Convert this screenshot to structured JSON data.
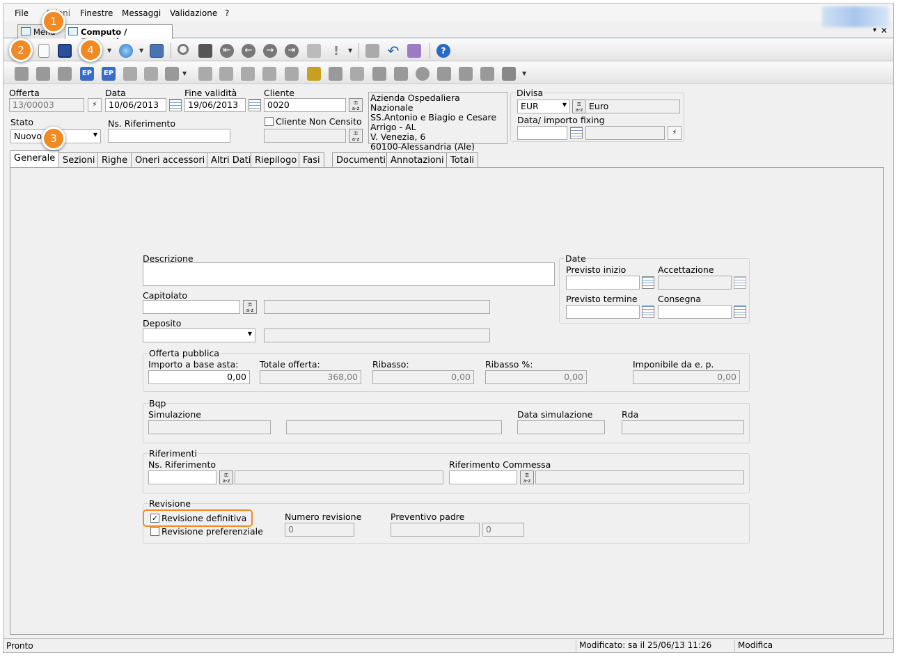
{
  "menu": {
    "file": "File",
    "azioni": "Azioni",
    "finestre": "Finestre",
    "messaggi": "Messaggi",
    "validazione": "Validazione",
    "help": "?"
  },
  "doc_tabs": {
    "tab1": "Menu",
    "tab2": "Computo / Preventivo",
    "pin": "▾",
    "close": "✕"
  },
  "callouts": {
    "c1": "1",
    "c2": "2",
    "c3": "3",
    "c4": "4"
  },
  "header": {
    "offerta_label": "Offerta",
    "offerta_value": "13/00003",
    "data_label": "Data",
    "data_value": "10/06/2013",
    "fine_label": "Fine validità",
    "fine_value": "19/06/2013",
    "cliente_label": "Cliente",
    "cliente_value": "0020",
    "cliente_non_censito": "Cliente Non Censito",
    "address": [
      "Azienda Ospedaliera Nazionale",
      "SS.Antonio e Biagio e Cesare",
      "Arrigo - AL",
      "V. Venezia, 6",
      "60100-Alessandria (Ale)"
    ],
    "divisa_label": "Divisa",
    "divisa_value": "EUR",
    "divisa_desc": "Euro",
    "fixing_label": "Data/ importo fixing",
    "stato_label": "Stato",
    "stato_value": "Nuovo",
    "nsrif_label": "Ns. Riferimento"
  },
  "tabs": [
    "Generale",
    "Sezioni",
    "Righe",
    "Oneri accessori",
    "Altri Dati",
    "Riepilogo",
    "Fasi",
    "Documenti",
    "Annotazioni",
    "Totali"
  ],
  "generale": {
    "descrizione": "Descrizione",
    "capitolato": "Capitolato",
    "deposito": "Deposito",
    "date_group": "Date",
    "previsto_inizio": "Previsto inizio",
    "accettazione": "Accettazione",
    "previsto_termine": "Previsto termine",
    "consegna": "Consegna",
    "offerta_pubblica": "Offerta pubblica",
    "importo_label": "Importo a base asta:",
    "importo_value": "0,00",
    "totale_label": "Totale offerta:",
    "totale_value": "368,00",
    "ribasso_label": "Ribasso:",
    "ribasso_value": "0,00",
    "ribasso_pct_label": "Ribasso %:",
    "ribasso_pct_value": "0,00",
    "imponibile_label": "Imponibile da e. p.",
    "imponibile_value": "0,00",
    "bqp": "Bqp",
    "simulazione": "Simulazione",
    "data_simulazione": "Data simulazione",
    "rda": "Rda",
    "riferimenti": "Riferimenti",
    "ns_rif": "Ns. Riferimento",
    "rif_commessa": "Riferimento Commessa",
    "revisione": "Revisione",
    "rev_definitiva": "Revisione definitiva",
    "rev_preferenziale": "Revisione preferenziale",
    "numero_revisione": "Numero revisione",
    "numero_revisione_value": "0",
    "preventivo_padre": "Preventivo padre",
    "preventivo_padre_value": "0"
  },
  "status": {
    "left": "Pronto",
    "modified": "Modificato: sa il 25/06/13 11:26",
    "mode": "Modifica"
  }
}
